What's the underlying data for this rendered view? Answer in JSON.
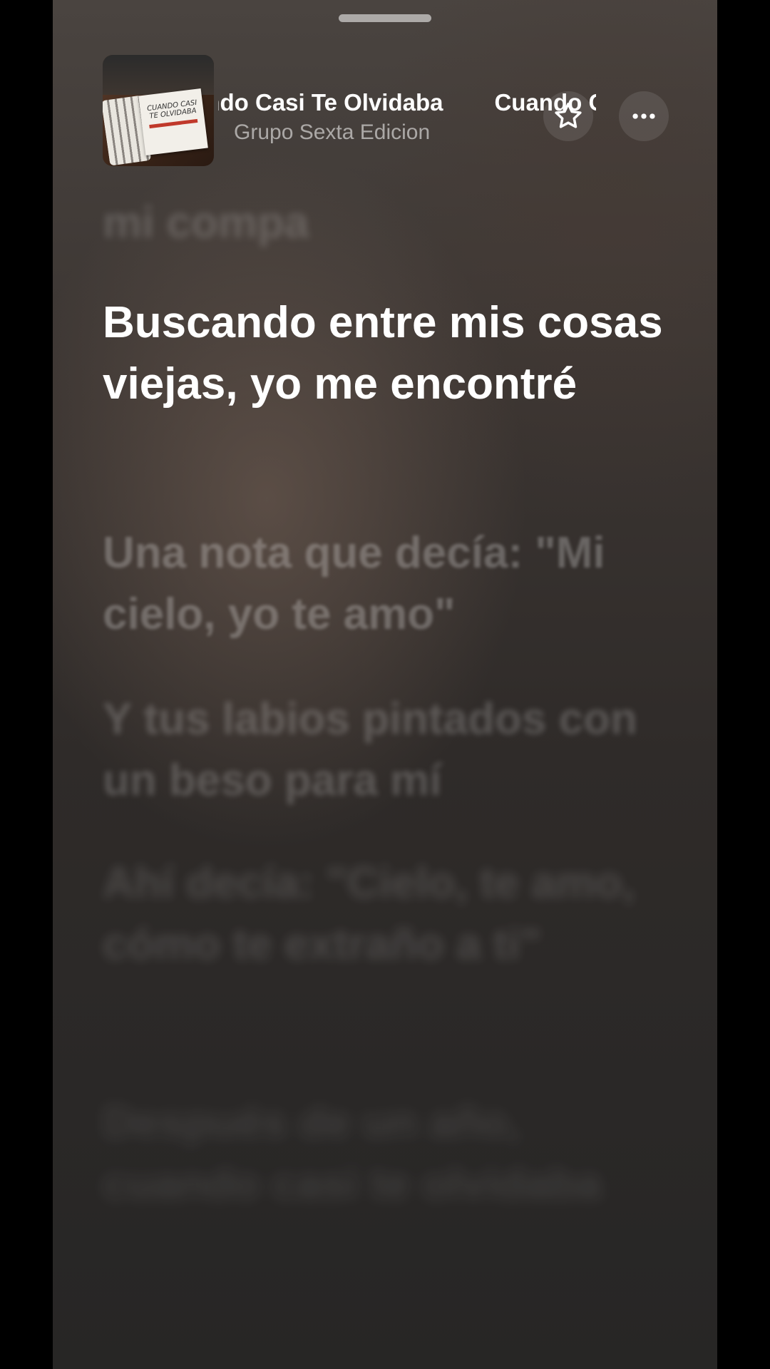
{
  "header": {
    "album_art_text": "CUANDO CASI TE OLVIDABA",
    "title": "Cuando Casi Te Olvidaba",
    "artist": "Grupo Sexta Edicion",
    "favorite_icon": "star-outline-icon",
    "more_icon": "ellipsis-icon"
  },
  "lyrics": {
    "previous_line": "mi compa",
    "current_line": "Buscando entre mis cosas viejas, yo me encontré",
    "upcoming_lines": [
      "Una nota que decía: \"Mi cielo, yo te amo\"",
      "Y tus labios pintados con un beso para mí",
      "Ahí decía: \"Cielo, te amo, cómo te extraño a ti\"",
      "Después de un año, cuando casi te olvidaba"
    ]
  },
  "colors": {
    "active_lyric": "#ffffff",
    "inactive_lyric": "rgba(255,255,255,0.25)"
  }
}
